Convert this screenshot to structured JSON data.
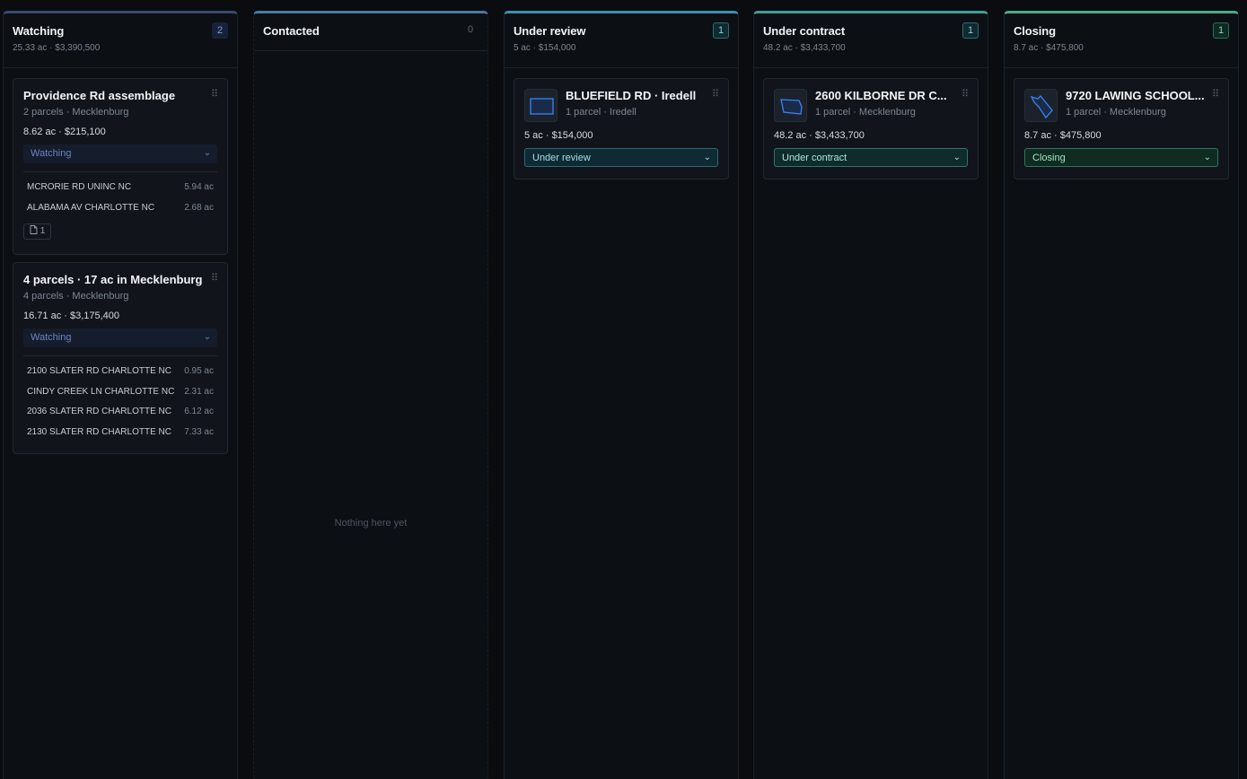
{
  "columns": [
    {
      "title": "Watching",
      "summary": "25.33 ac · $3,390,500",
      "count": "2"
    },
    {
      "title": "Contacted",
      "summary": "",
      "count": "0",
      "empty_text": "Nothing here yet"
    },
    {
      "title": "Under review",
      "summary": "5 ac · $154,000",
      "count": "1"
    },
    {
      "title": "Under contract",
      "summary": "48.2 ac · $3,433,700",
      "count": "1"
    },
    {
      "title": "Closing",
      "summary": "8.7 ac · $475,800",
      "count": "1"
    }
  ],
  "cards": {
    "providence": {
      "title": "Providence Rd assemblage",
      "meta": "2 parcels · Mecklenburg",
      "nums": "8.62 ac · $215,100",
      "status": "Watching",
      "parcels": [
        {
          "addr": "MCRORIE RD UNINC NC",
          "ac": "5.94 ac"
        },
        {
          "addr": "ALABAMA AV CHARLOTTE NC",
          "ac": "2.68 ac"
        }
      ],
      "doc_count": "1"
    },
    "four_parcels": {
      "title": "4 parcels · 17 ac in Mecklenburg",
      "meta": "4 parcels · Mecklenburg",
      "nums": "16.71 ac · $3,175,400",
      "status": "Watching",
      "parcels": [
        {
          "addr": "2100 SLATER RD CHARLOTTE NC",
          "ac": "0.95 ac"
        },
        {
          "addr": "CINDY CREEK LN CHARLOTTE NC",
          "ac": "2.31 ac"
        },
        {
          "addr": "2036 SLATER RD CHARLOTTE NC",
          "ac": "6.12 ac"
        },
        {
          "addr": "2130 SLATER RD CHARLOTTE NC",
          "ac": "7.33 ac"
        }
      ]
    },
    "bluefield": {
      "title": "BLUEFIELD RD · Iredell",
      "meta": "1 parcel · Iredell",
      "nums": "5 ac · $154,000",
      "status": "Under review"
    },
    "kilborne": {
      "title": "2600 KILBORNE DR C...",
      "meta": "1 parcel · Mecklenburg",
      "nums": "48.2 ac · $3,433,700",
      "status": "Under contract"
    },
    "lawing": {
      "title": "9720 LAWING SCHOOL...",
      "meta": "1 parcel · Mecklenburg",
      "nums": "8.7 ac · $475,800",
      "status": "Closing"
    }
  },
  "icons": {
    "drag": "drag-handle-icon",
    "chevron": "chevron-down-icon",
    "document": "document-icon",
    "parcel_shape": "parcel-shape-icon"
  },
  "colors": {
    "background": "#0a0c10",
    "watching_accent": "#3a4a70",
    "review_accent": "#3e8fb0",
    "contract_accent": "#3f9f9a",
    "closing_accent": "#4aae86",
    "parcel_outline": "#3b82f6"
  }
}
